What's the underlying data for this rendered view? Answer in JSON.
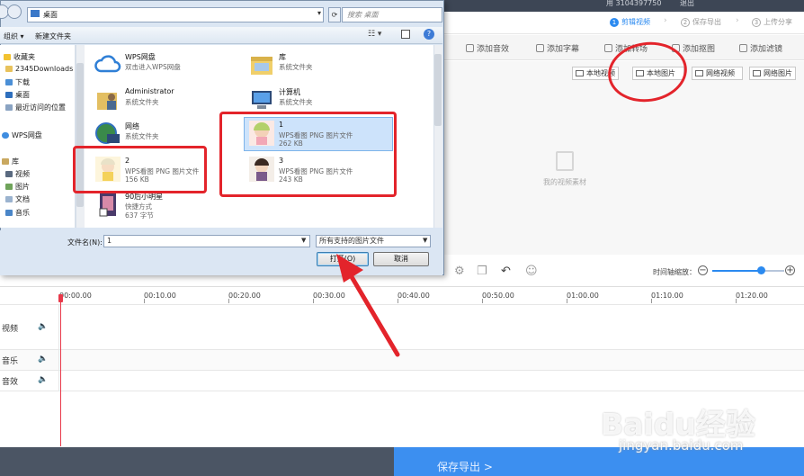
{
  "app": {
    "topbar": {
      "account": "用 3104397750",
      "exit": "退出"
    },
    "steps": [
      {
        "num": "1",
        "label": "剪辑视频",
        "active": true
      },
      {
        "num": "2",
        "label": "保存导出",
        "active": false
      },
      {
        "num": "3",
        "label": "上传分享",
        "active": false
      }
    ],
    "toolbar": [
      "添加音效",
      "添加字幕",
      "添加转场",
      "添加抠图",
      "添加滤镜"
    ],
    "sources": [
      "本地视频",
      "本地图片",
      "网络视频",
      "网络图片"
    ],
    "media_empty": "我的视频素材",
    "zoom_label": "时间轴缩放：",
    "timeline_ticks": [
      "00:00.00",
      "00:10.00",
      "00:20.00",
      "00:30.00",
      "00:40.00",
      "00:50.00",
      "01:00.00",
      "01:10.00",
      "01:20.00"
    ],
    "tracks": [
      "视频",
      "音乐",
      "音效"
    ],
    "export_label": "保存导出 >",
    "watermark": {
      "logo": "Baidu经验",
      "url": "jingyan.baidu.com"
    }
  },
  "dialog": {
    "address": "桌面",
    "search_placeholder": "搜索 桌面",
    "organize": "组织 ▾",
    "new_folder": "新建文件夹",
    "nav": [
      {
        "label": "收藏夹",
        "icon": "star-icon"
      },
      {
        "label": "2345Downloads",
        "icon": "folder-icon"
      },
      {
        "label": "下载",
        "icon": "download-icon"
      },
      {
        "label": "桌面",
        "icon": "desktop-icon"
      },
      {
        "label": "最近访问的位置",
        "icon": "recent-icon"
      },
      {
        "label": "WPS网盘",
        "icon": "cloud-icon"
      },
      {
        "label": "库",
        "icon": "library-icon"
      },
      {
        "label": "视频",
        "icon": "video-icon"
      },
      {
        "label": "图片",
        "icon": "picture-icon"
      },
      {
        "label": "文档",
        "icon": "document-icon"
      },
      {
        "label": "音乐",
        "icon": "music-icon"
      }
    ],
    "files": [
      {
        "name": "WPS网盘",
        "desc": "双击进入WPS网盘",
        "size": ""
      },
      {
        "name": "库",
        "desc": "系统文件夹",
        "size": ""
      },
      {
        "name": "Administrator",
        "desc": "系统文件夹",
        "size": ""
      },
      {
        "name": "计算机",
        "desc": "系统文件夹",
        "size": ""
      },
      {
        "name": "网络",
        "desc": "系统文件夹",
        "size": ""
      },
      {
        "name": "1",
        "desc": "WPS看图 PNG 图片文件",
        "size": "262 KB"
      },
      {
        "name": "2",
        "desc": "WPS看图 PNG 图片文件",
        "size": "156 KB"
      },
      {
        "name": "3",
        "desc": "WPS看图 PNG 图片文件",
        "size": "243 KB"
      },
      {
        "name": "90后小明星",
        "desc": "快捷方式",
        "size": "637 字节"
      }
    ],
    "filename_label": "文件名(N):",
    "filename_value": "1",
    "filetype": "所有支持的图片文件",
    "open": "打开(O)",
    "cancel": "取消"
  },
  "colors": {
    "accent": "#2b8af0",
    "annotation": "#e3242b",
    "playhead": "#e8394a"
  }
}
